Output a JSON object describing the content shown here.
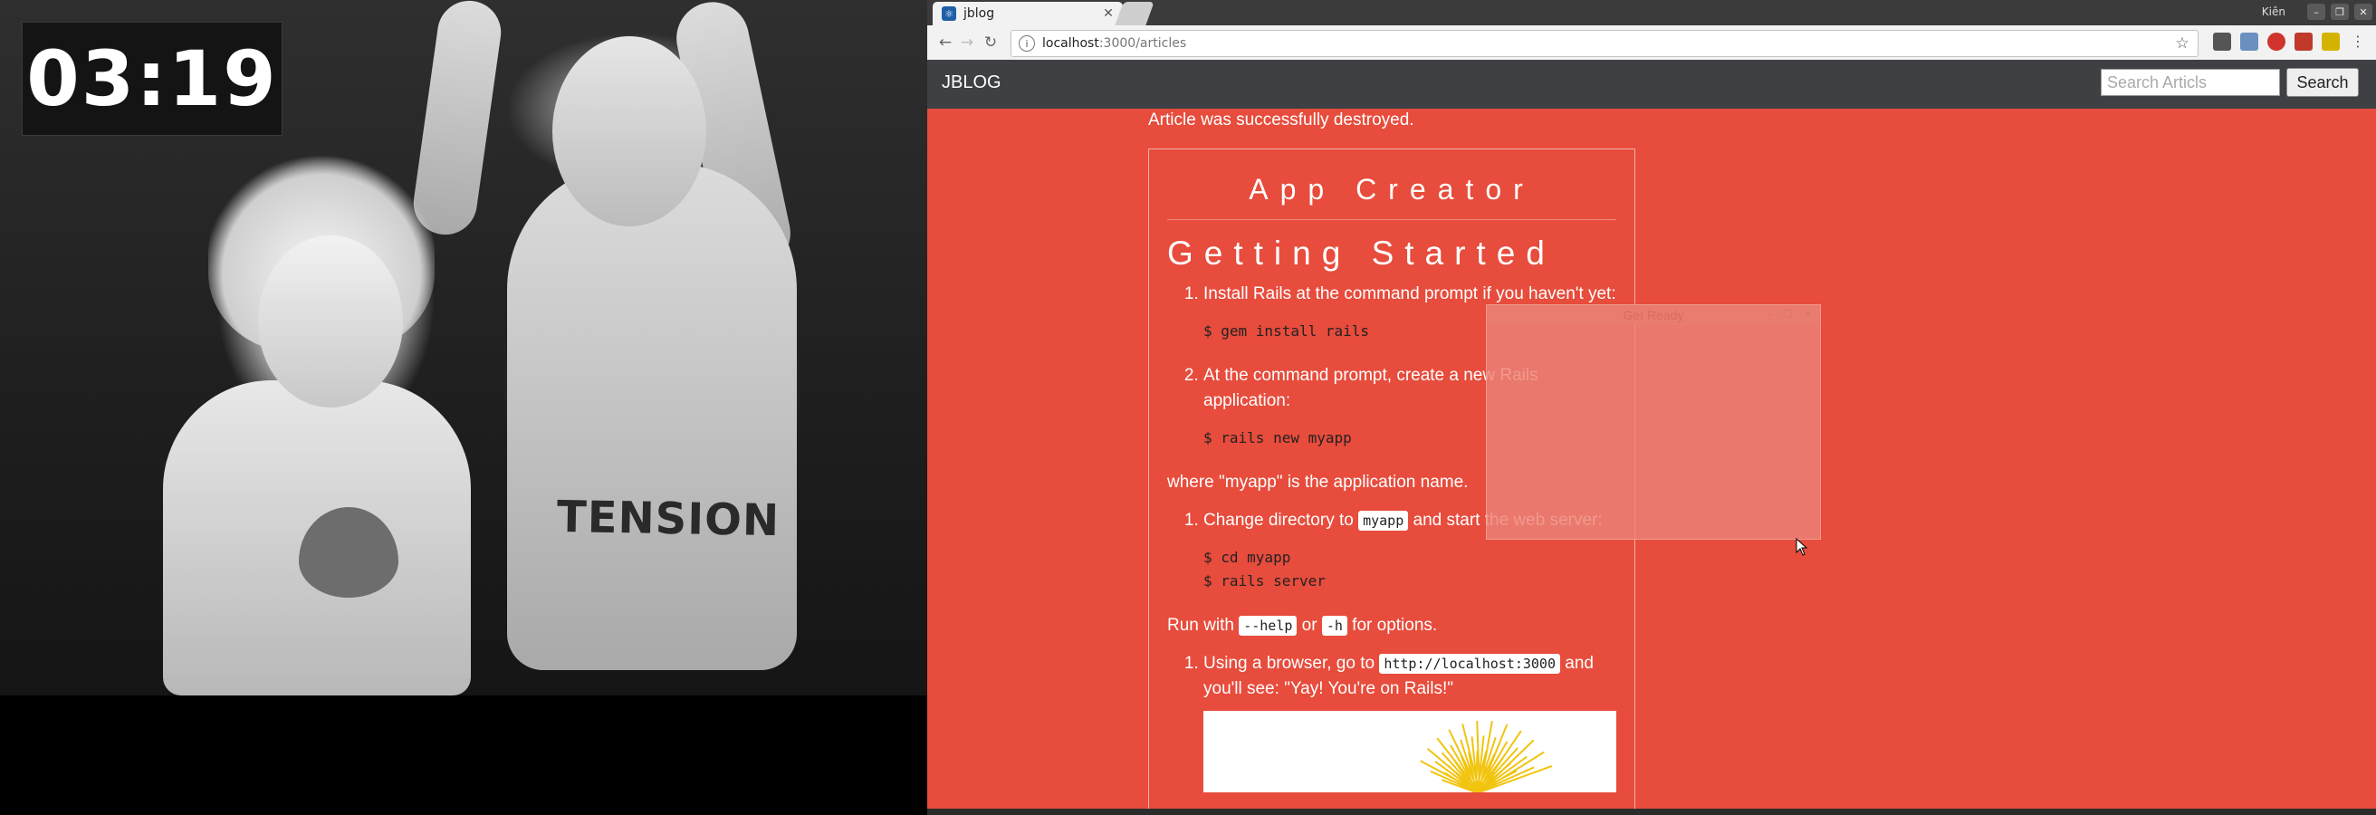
{
  "timer": {
    "text": "03:19"
  },
  "photo": {
    "tattoo_text": "TENSION"
  },
  "browser": {
    "tab": {
      "title": "jblog"
    },
    "window": {
      "user_name": "Kiên"
    },
    "address": {
      "host": "localhost",
      "path": ":3000/articles"
    },
    "extensions": [
      "grid-icon",
      "cast-icon",
      "adblock-icon",
      "badge-icon",
      "puzzle-icon"
    ]
  },
  "nav": {
    "brand": "JBLOG",
    "search_placeholder": "Search Articls",
    "search_label": "Search"
  },
  "flash": {
    "notice": "Article was successfully destroyed."
  },
  "article": {
    "title": "App Creator",
    "heading": "Getting Started",
    "step1": "Install Rails at the command prompt if you haven't yet:",
    "cmd1": "$ gem install rails",
    "step2": "At the command prompt, create a new Rails application:",
    "cmd2": "$ rails new myapp",
    "where_text": "where \"myapp\" is the application name.",
    "step3_before": "Change directory to ",
    "step3_code": "myapp",
    "step3_after": " and start the web server:",
    "cmd3a": "$ cd myapp",
    "cmd3b": "$ rails server",
    "run_before": "Run with ",
    "run_code1": "--help",
    "run_mid": " or ",
    "run_code2": "-h",
    "run_after": " for options.",
    "step4_before": "Using a browser, go to ",
    "step4_code": "http://localhost:3000",
    "step4_after": " and you'll see: \"Yay! You're on Rails!\""
  },
  "popup": {
    "title": "Get Ready"
  },
  "colors": {
    "page_bg": "#e74c3c",
    "nav_bg": "#3e4044"
  }
}
